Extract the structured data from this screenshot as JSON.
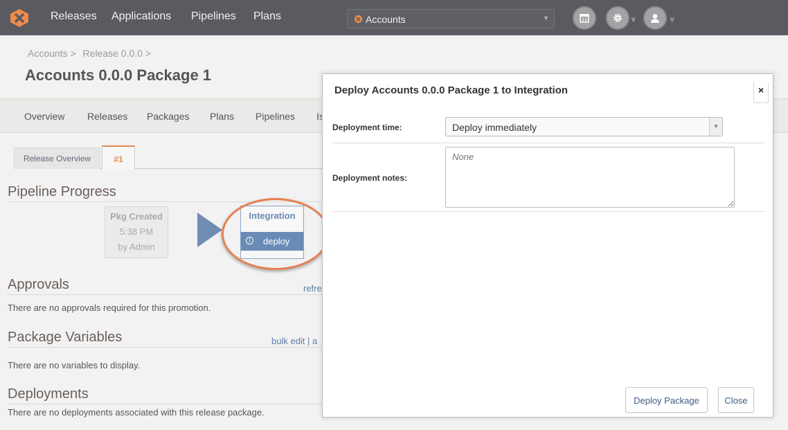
{
  "topnav": {
    "links": [
      "Releases",
      "Applications",
      "Pipelines",
      "Plans"
    ],
    "app_selector": "Accounts"
  },
  "breadcrumb": [
    "Accounts >",
    "Release 0.0.0 >"
  ],
  "page_title": "Accounts 0.0.0 Package 1",
  "subnav": [
    "Overview",
    "Releases",
    "Packages",
    "Plans",
    "Pipelines",
    "Is"
  ],
  "tabs": [
    "Release Overview",
    "#1"
  ],
  "pipeline": {
    "heading": "Pipeline Progress",
    "pkg_title": "Pkg Created",
    "pkg_time": "5:38 PM",
    "pkg_by": "by Admin",
    "stage_title": "Integration",
    "stage_action": "deploy"
  },
  "approvals": {
    "heading": "Approvals",
    "link": "refre",
    "text": "There are no approvals required for this promotion."
  },
  "variables": {
    "heading": "Package Variables",
    "link": "bulk edit | a",
    "text": "There are no variables to display."
  },
  "deployments": {
    "heading": "Deployments",
    "text": "There are no deployments associated with this release package."
  },
  "modal": {
    "title": "Deploy Accounts 0.0.0 Package 1 to Integration",
    "close_icon": "×",
    "time_label": "Deployment time:",
    "time_value": "Deploy immediately",
    "notes_label": "Deployment notes:",
    "notes_placeholder": "None",
    "deploy_button": "Deploy Package",
    "close_button": "Close"
  },
  "colors": {
    "accent": "#e8874b",
    "nav_bg": "#5a5b60",
    "stage_blue": "#6a8bb5"
  }
}
